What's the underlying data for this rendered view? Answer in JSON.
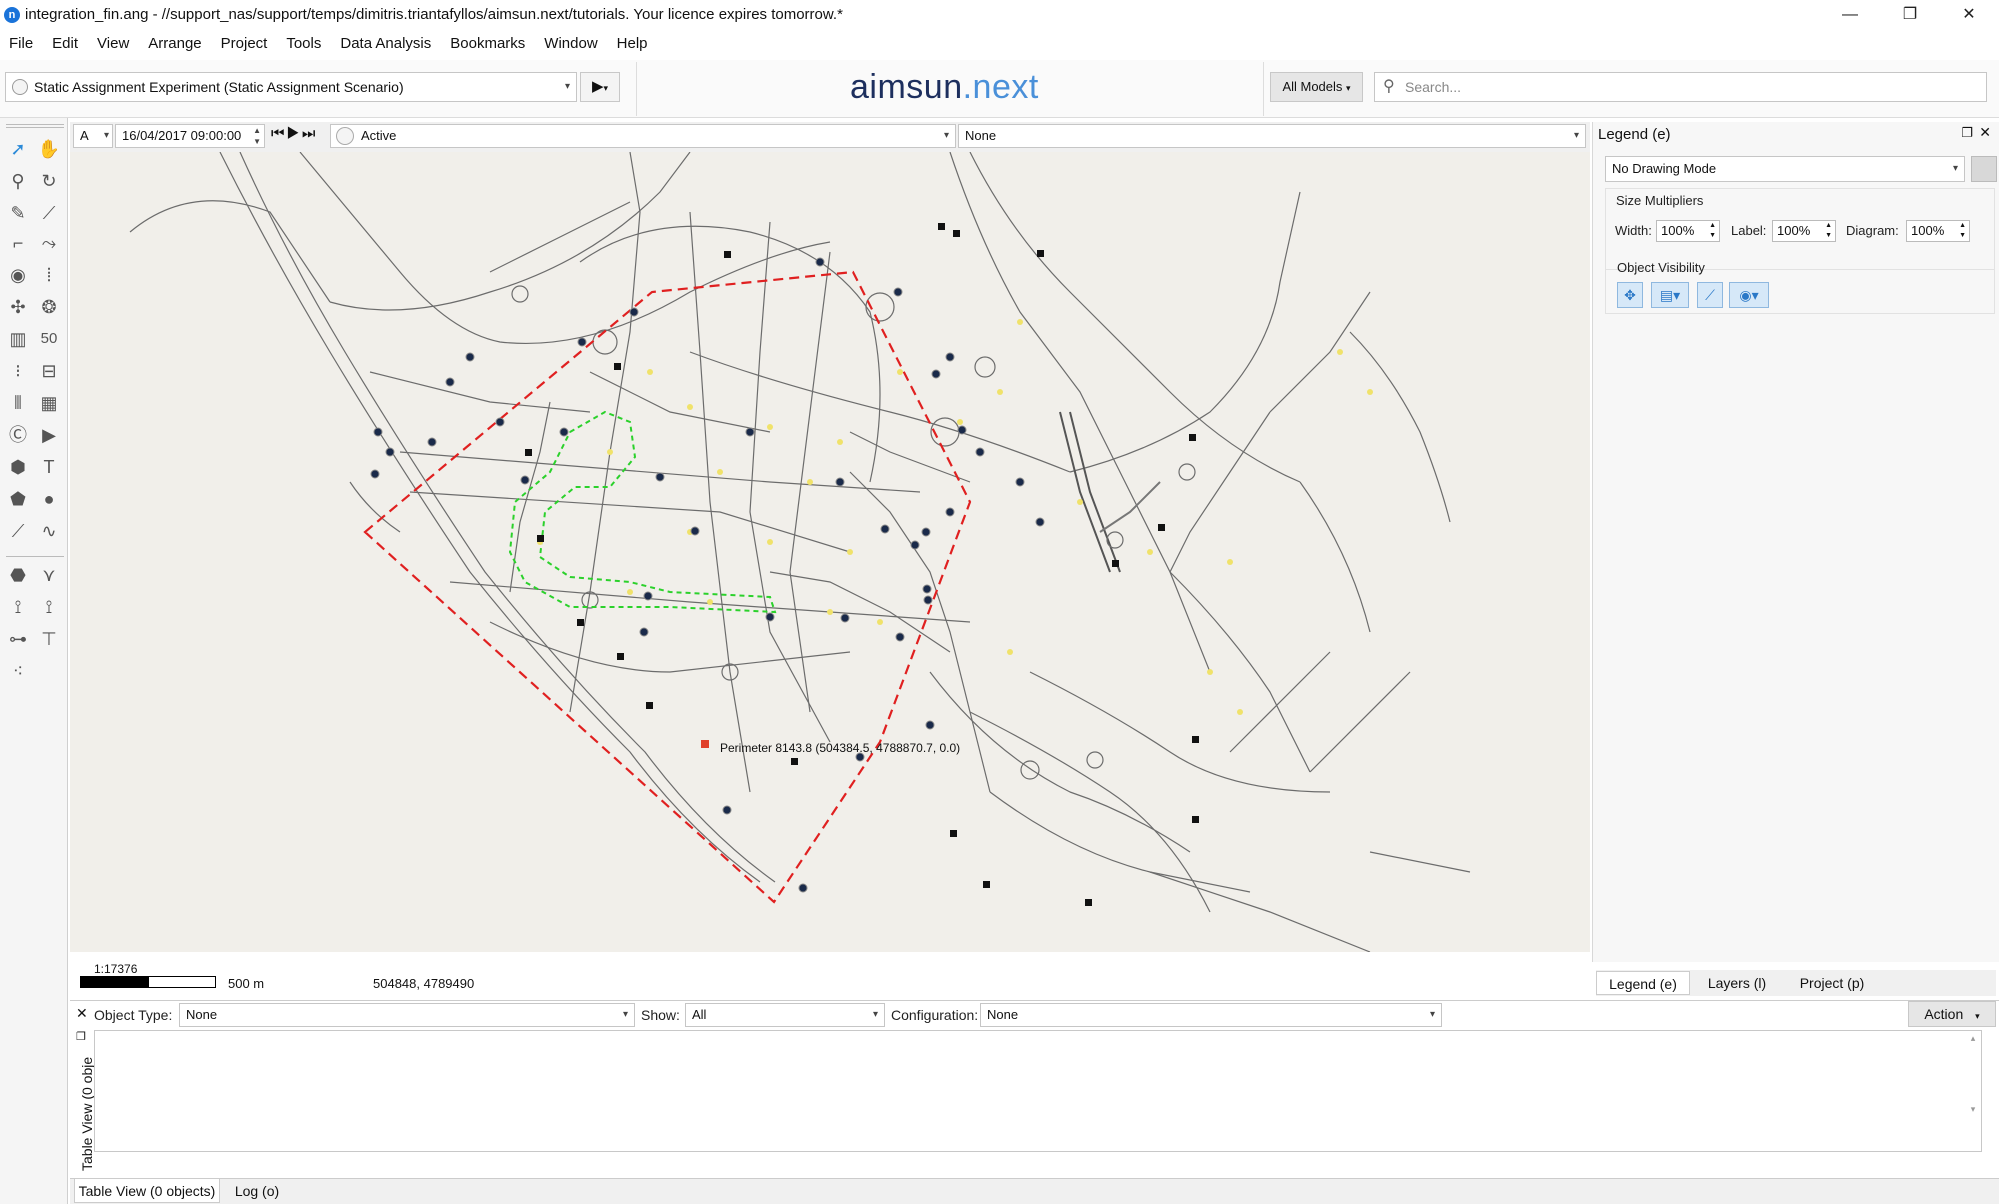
{
  "window": {
    "title": "integration_fin.ang - //support_nas/support/temps/dimitris.triantafyllos/aimsun.next/tutorials. Your licence expires tomorrow.*",
    "minimize_glyph": "—",
    "restore_glyph": "❐",
    "close_glyph": "✕"
  },
  "menu": [
    "File",
    "Edit",
    "View",
    "Arrange",
    "Project",
    "Tools",
    "Data Analysis",
    "Bookmarks",
    "Window",
    "Help"
  ],
  "toolbar": {
    "experiment": "Static Assignment Experiment (Static Assignment Scenario)",
    "logo_main": "aimsun",
    "logo_dot": ".next",
    "models_label": "All Models",
    "search_placeholder": "Search..."
  },
  "mapbar": {
    "layer": "A",
    "datetime": "16/04/2017 09:00:00",
    "status": "Active",
    "view_mode": "None"
  },
  "map": {
    "perimeter_label": "Perimeter 8143.8 (504384.5, 4788870.7, 0.0)",
    "scale_ratio": "1:17376",
    "scale_distance": "500 m",
    "coordinates": "504848, 4789490",
    "colors": {
      "background": "#f1efea",
      "road": "#6c6c6c",
      "perimeter": "#e02020",
      "subarea": "#2bd12b",
      "node": "#f0e26a",
      "centroid": "#1a2a4a"
    }
  },
  "legend": {
    "title": "Legend (e)",
    "drawing_mode": "No Drawing Mode",
    "size_multipliers": "Size Multipliers",
    "width_label": "Width:",
    "width_value": "100%",
    "label_label": "Label:",
    "label_value": "100%",
    "diagram_label": "Diagram:",
    "diagram_value": "100%",
    "object_visibility": "Object Visibility"
  },
  "side_tabs": [
    "Legend (e)",
    "Layers (l)",
    "Project (p)"
  ],
  "table": {
    "object_type_label": "Object Type:",
    "object_type_value": "None",
    "show_label": "Show:",
    "show_value": "All",
    "configuration_label": "Configuration:",
    "configuration_value": "None",
    "action_label": "Action",
    "vertical_label": "Table View (0 obje"
  },
  "bottom_tabs": [
    "Table View (0 objects)",
    "Log (o)"
  ]
}
